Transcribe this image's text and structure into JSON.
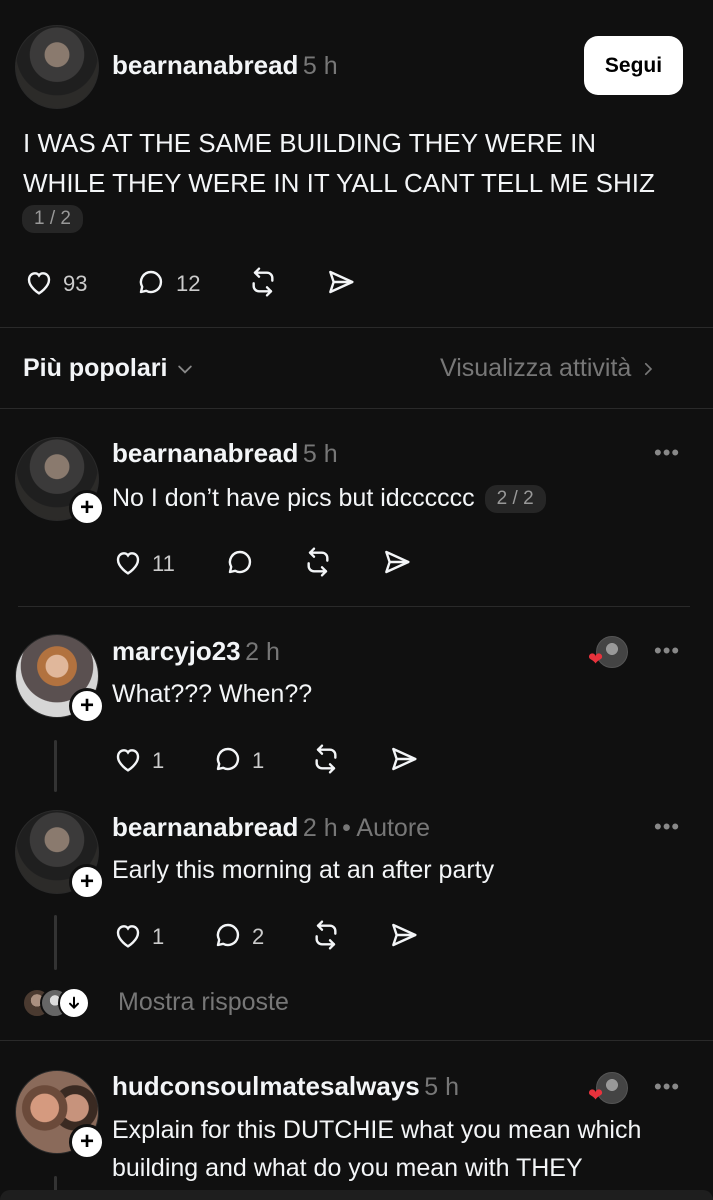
{
  "post": {
    "username": "bearnanabread",
    "time": "5 h",
    "follow_label": "Segui",
    "text_line1": "I WAS AT THE SAME BUILDING THEY WERE IN",
    "text_line2": "WHILE THEY WERE IN IT YALL CANT TELL ME SHIZ",
    "page_badge": "1 / 2",
    "likes": "93",
    "comments": "12"
  },
  "sort_bar": {
    "sort_label": "Più popolari",
    "activity_label": "Visualizza attività"
  },
  "replies": [
    {
      "username": "bearnanabread",
      "time": "5 h",
      "text": "No I don’t have pics but idcccccc",
      "page_badge": "2 / 2",
      "likes": "11",
      "comments": ""
    },
    {
      "username": "marcyjo23",
      "time": "2 h",
      "text": "What??? When??",
      "likes": "1",
      "comments": "1"
    },
    {
      "username": "bearnanabread",
      "time": "2 h",
      "author_tag": "• Autore",
      "text": "Early this morning at an after party",
      "likes": "1",
      "comments": "2"
    },
    {
      "username": "hudconsoulmatesalways",
      "time": "5 h",
      "text_line1": "Explain for this DUTCHIE what you mean which",
      "text_line2": "building and what do you mean with THEY"
    }
  ],
  "show_replies_label": "Mostra risposte",
  "colors": {
    "background": "#101010",
    "text": "#f3f5f7",
    "muted": "#777777",
    "heart_red": "#e8323c"
  }
}
